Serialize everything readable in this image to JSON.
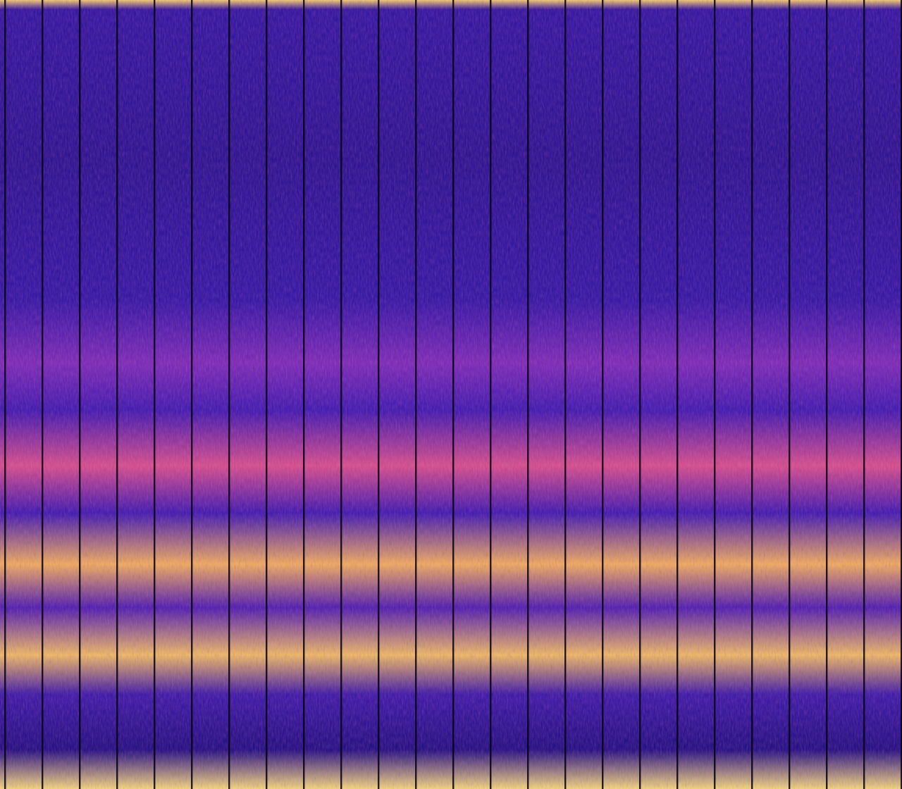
{
  "view": {
    "kind": "spectrogram"
  }
}
